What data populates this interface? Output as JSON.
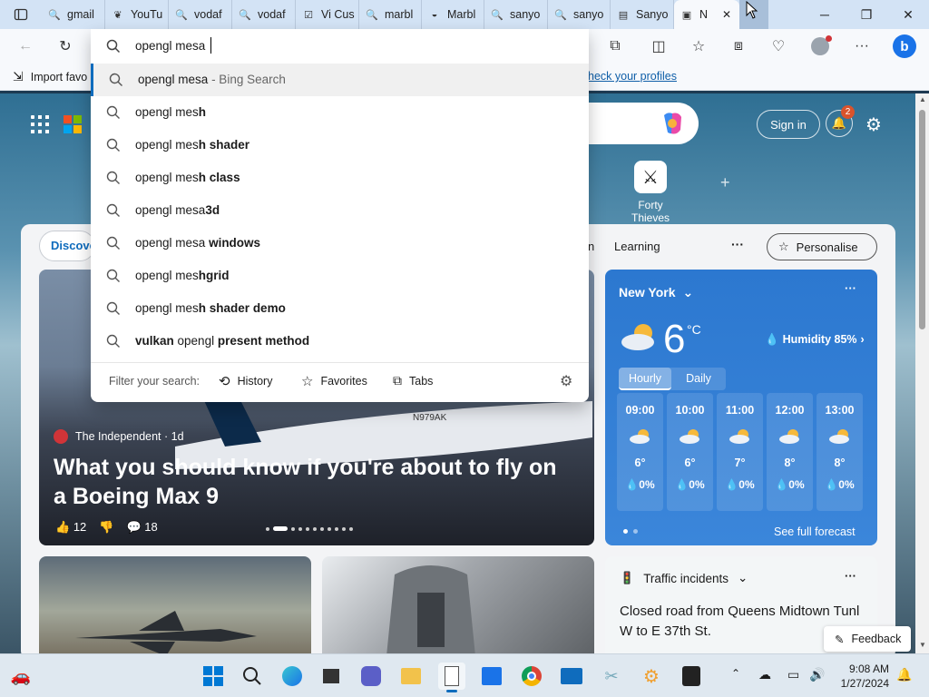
{
  "tabs": [
    {
      "label": "gmail",
      "icon": "search-icon"
    },
    {
      "label": "YouTu",
      "icon": "bookmark-icon"
    },
    {
      "label": "vodaf",
      "icon": "search-icon"
    },
    {
      "label": "vodaf",
      "icon": "search-icon"
    },
    {
      "label": "Vi Cus",
      "icon": "check-shield-icon"
    },
    {
      "label": "marbl",
      "icon": "search-icon"
    },
    {
      "label": "Marbl",
      "icon": "marble-icon"
    },
    {
      "label": "sanyo",
      "icon": "search-icon"
    },
    {
      "label": "sanyo",
      "icon": "search-icon"
    },
    {
      "label": "Sanyo",
      "icon": "flag-icon"
    },
    {
      "label": "N",
      "icon": "newtab-icon",
      "active": true
    }
  ],
  "address_bar": {
    "value": "opengl mesa"
  },
  "favorites_bar": {
    "import_label": "Import favo",
    "profiles_link": "heck your profiles"
  },
  "suggestions": [
    {
      "normal": "opengl mesa",
      "bold": "",
      "suffix": " - Bing Search",
      "highlighted": true
    },
    {
      "normal": "opengl mes",
      "bold": "h",
      "suffix": ""
    },
    {
      "normal": "opengl mes",
      "bold": "h shader",
      "suffix": ""
    },
    {
      "normal": "opengl mes",
      "bold": "h class",
      "suffix": ""
    },
    {
      "normal": "opengl mesa",
      "bold": "3d",
      "suffix": ""
    },
    {
      "normal": "opengl mesa",
      "bold": " windows",
      "suffix": ""
    },
    {
      "normal": "opengl mes",
      "bold": "hgrid",
      "suffix": ""
    },
    {
      "normal": "opengl mes",
      "bold": "h shader demo",
      "suffix": ""
    },
    {
      "lead_bold": "vulkan",
      "normal": " opengl ",
      "bold": "present method",
      "suffix": ""
    }
  ],
  "filter": {
    "label": "Filter your search:",
    "history": "History",
    "favorites": "Favorites",
    "tabs": "Tabs"
  },
  "ntp": {
    "sign_in": "Sign in",
    "notification_count": "2",
    "quick_link": "Forty Thieves",
    "nav": {
      "discover": "Discove",
      "partial": "n",
      "learning": "Learning",
      "more": "···",
      "personalise": "Personalise"
    }
  },
  "hero": {
    "source": "The Independent · 1d",
    "headline": "What you should know if you're about to fly on a Boeing Max 9",
    "likes": "12",
    "comments": "18",
    "tail_number": "N979AK"
  },
  "weather": {
    "city": "New York",
    "temp": "6",
    "unit": "°C",
    "humidity": "Humidity 85%",
    "tab_hourly": "Hourly",
    "tab_daily": "Daily",
    "hours": [
      {
        "time": "09:00",
        "temp": "6°",
        "precip": "0%"
      },
      {
        "time": "10:00",
        "temp": "6°",
        "precip": "0%"
      },
      {
        "time": "11:00",
        "temp": "7°",
        "precip": "0%"
      },
      {
        "time": "12:00",
        "temp": "8°",
        "precip": "0%"
      },
      {
        "time": "13:00",
        "temp": "8°",
        "precip": "0%"
      }
    ],
    "forecast_link": "See full forecast"
  },
  "traffic": {
    "title": "Traffic incidents",
    "headline": "Closed road from Queens Midtown Tunl W to E 37th St."
  },
  "feedback": "Feedback",
  "taskbar": {
    "time": "9:08 AM",
    "date": "1/27/2024"
  },
  "colors": {
    "accent": "#0f6cbd",
    "weather_bg": "#2f7bd0",
    "tabstrip": "#d3e3f5"
  }
}
